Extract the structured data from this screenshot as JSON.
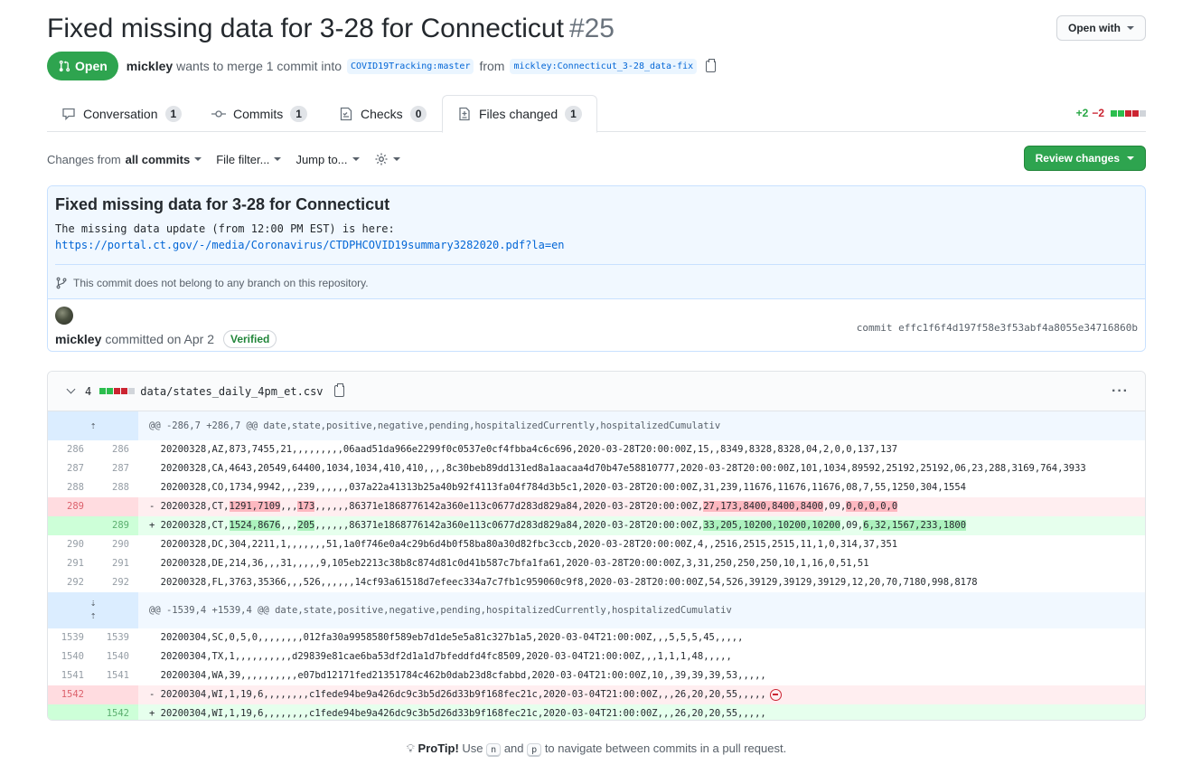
{
  "pr": {
    "title": "Fixed missing data for 3-28 for Connecticut",
    "number": "#25",
    "state": "Open",
    "author": "mickley",
    "merge_text": "wants to merge 1 commit into",
    "base_branch": "COVID19Tracking:master",
    "from_text": "from",
    "head_branch": "mickley:Connecticut_3-28_data-fix",
    "open_with": "Open with"
  },
  "tabs": [
    {
      "label": "Conversation",
      "count": "1",
      "icon": "comment-icon"
    },
    {
      "label": "Commits",
      "count": "1",
      "icon": "commit-icon"
    },
    {
      "label": "Checks",
      "count": "0",
      "icon": "checklist-icon"
    },
    {
      "label": "Files changed",
      "count": "1",
      "icon": "file-diff-icon"
    }
  ],
  "diffstat": {
    "additions": "+2",
    "deletions": "−2"
  },
  "toolbar": {
    "changes_prefix": "Changes from",
    "changes_value": "all commits",
    "file_filter": "File filter...",
    "jump_to": "Jump to...",
    "review": "Review changes"
  },
  "commit": {
    "title": "Fixed missing data for 3-28 for Connecticut",
    "desc_line1": "The missing data update (from 12:00 PM EST) is here:",
    "desc_link": "https://portal.ct.gov/-/media/Coronavirus/CTDPHCOVID19summary3282020.pdf?la=en",
    "branch_note": "This commit does not belong to any branch on this repository.",
    "author": "mickley",
    "committed": "committed on Apr 2",
    "verified": "Verified",
    "sha": "commit effc1f6f4d197f58e3f53abf4a8055e34716860b"
  },
  "file": {
    "count": "4",
    "name": "data/states_daily_4pm_et.csv",
    "hunk1": "@@ -286,7 +286,7 @@ date,state,positive,negative,pending,hospitalizedCurrently,hospitalizedCumulativ",
    "hunk2": "@@ -1539,4 +1539,4 @@ date,state,positive,negative,pending,hospitalizedCurrently,hospitalizedCumulativ",
    "rows1": [
      {
        "old": "286",
        "new": "286",
        "code": "  20200328,AZ,873,7455,21,,,,,,,,,06aad51da966e2299f0c0537e0cf4fbba4c6c696,2020-03-28T20:00:00Z,15,,8349,8328,8328,04,2,0,0,137,137"
      },
      {
        "old": "287",
        "new": "287",
        "code": "  20200328,CA,4643,20549,64400,1034,1034,410,410,,,,8c30beb89dd131ed8a1aacaa4d70b47e58810777,2020-03-28T20:00:00Z,101,1034,89592,25192,25192,06,23,288,3169,764,3933"
      },
      {
        "old": "288",
        "new": "288",
        "code": "  20200328,CO,1734,9942,,,239,,,,,,037a22a41313b25a40b92f4113fa04f784d3b5c1,2020-03-28T20:00:00Z,31,239,11676,11676,11676,08,7,55,1250,304,1554"
      }
    ],
    "del1": {
      "old": "289",
      "parts": [
        "- 20200328,CT,",
        "1291,7109",
        ",,,",
        "173",
        ",,,,,,86371e1868776142a360e113c0677d283d829a84,2020-03-28T20:00:00Z,",
        "27,173,8400,8400,8400",
        ",09,",
        "0,0,0,0,0"
      ]
    },
    "add1": {
      "new": "289",
      "parts": [
        "+ 20200328,CT,",
        "1524,8676",
        ",,,",
        "205",
        ",,,,,,86371e1868776142a360e113c0677d283d829a84,2020-03-28T20:00:00Z,",
        "33,205,10200,10200,10200",
        ",09,",
        "6,32,1567,233,1800"
      ]
    },
    "rows2": [
      {
        "old": "290",
        "new": "290",
        "code": "  20200328,DC,304,2211,1,,,,,,,51,1a0f746e0a4c29b6d4b0f58ba80a30d82fbc3ccb,2020-03-28T20:00:00Z,4,,2516,2515,2515,11,1,0,314,37,351"
      },
      {
        "old": "291",
        "new": "291",
        "code": "  20200328,DE,214,36,,,31,,,,,9,105eb2213c38b8c874d81c0d41b587c7bfa1fa61,2020-03-28T20:00:00Z,3,31,250,250,250,10,1,16,0,51,51"
      },
      {
        "old": "292",
        "new": "292",
        "code": "  20200328,FL,3763,35366,,,526,,,,,,14cf93a61518d7efeec334a7c7fb1c959060c9f8,2020-03-28T20:00:00Z,54,526,39129,39129,39129,12,20,70,7180,998,8178"
      }
    ],
    "rows3": [
      {
        "old": "1539",
        "new": "1539",
        "code": "  20200304,SC,0,5,0,,,,,,,,012fa30a9958580f589eb7d1de5e5a81c327b1a5,2020-03-04T21:00:00Z,,,5,5,5,45,,,,,"
      },
      {
        "old": "1540",
        "new": "1540",
        "code": "  20200304,TX,1,,,,,,,,,,d29839e81cae6ba53df2d1a1d7bfeddfd4fc8509,2020-03-04T21:00:00Z,,,1,1,1,48,,,,,"
      },
      {
        "old": "1541",
        "new": "1541",
        "code": "  20200304,WA,39,,,,,,,,,,e07bd12171fed21351784c462b0dab23d8cfabbd,2020-03-04T21:00:00Z,10,,39,39,39,53,,,,,"
      }
    ],
    "del2": {
      "old": "1542",
      "code": "- 20200304,WI,1,19,6,,,,,,,,c1fede94be9a426dc9c3b5d26d33b9f168fec21c,2020-03-04T21:00:00Z,,,26,20,20,55,,,,,"
    },
    "add2": {
      "new": "1542",
      "code": "+ 20200304,WI,1,19,6,,,,,,,,c1fede94be9a426dc9c3b5d26d33b9f168fec21c,2020-03-04T21:00:00Z,,,26,20,20,55,,,,,"
    }
  },
  "protip": {
    "label": "ProTip!",
    "t1": "Use",
    "k1": "n",
    "t2": "and",
    "k2": "p",
    "t3": "to navigate between commits in a pull request."
  },
  "colors": {
    "green": "#2ea44f",
    "red": "#cb2431",
    "link": "#0366d6"
  }
}
